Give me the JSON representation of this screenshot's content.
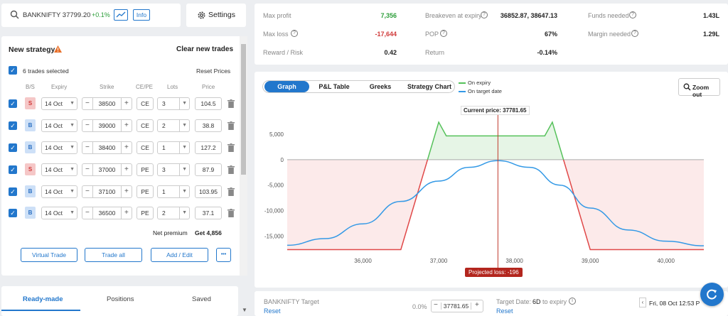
{
  "search": {
    "symbol": "BANKNIFTY 37799.20",
    "change": "+0.1%",
    "info_label": "Info"
  },
  "settings_label": "Settings",
  "strategy": {
    "title": "New strategy",
    "clear_label": "Clear new trades",
    "trades_selected": "6 trades selected",
    "reset_prices": "Reset Prices",
    "headers": {
      "bs": "B/S",
      "expiry": "Expiry",
      "strike": "Strike",
      "cepe": "CE/PE",
      "lots": "Lots",
      "price": "Price"
    },
    "rows": [
      {
        "bs": "S",
        "expiry": "14 Oct",
        "strike": "38500",
        "type": "CE",
        "lots": "3",
        "price": "104.5"
      },
      {
        "bs": "B",
        "expiry": "14 Oct",
        "strike": "39000",
        "type": "CE",
        "lots": "2",
        "price": "38.8"
      },
      {
        "bs": "B",
        "expiry": "14 Oct",
        "strike": "38400",
        "type": "CE",
        "lots": "1",
        "price": "127.2"
      },
      {
        "bs": "S",
        "expiry": "14 Oct",
        "strike": "37000",
        "type": "PE",
        "lots": "3",
        "price": "87.9"
      },
      {
        "bs": "B",
        "expiry": "14 Oct",
        "strike": "37100",
        "type": "PE",
        "lots": "1",
        "price": "103.95"
      },
      {
        "bs": "B",
        "expiry": "14 Oct",
        "strike": "36500",
        "type": "PE",
        "lots": "2",
        "price": "37.1"
      }
    ],
    "net_premium_label": "Net premium",
    "net_premium_value": "Get 4,856",
    "virtual_trade": "Virtual Trade",
    "trade_all": "Trade all",
    "add_edit": "Add / Edit",
    "more": "•••"
  },
  "bottom_tabs": [
    "Ready-made",
    "Positions",
    "Saved"
  ],
  "metrics": {
    "max_profit_label": "Max profit",
    "max_profit": "7,356",
    "max_loss_label": "Max loss",
    "max_loss": "-17,644",
    "rr_label": "Reward / Risk",
    "rr": "0.42",
    "breakeven_label": "Breakeven at expiry",
    "breakeven": "36852.87, 38647.13",
    "pop_label": "POP",
    "pop": "67%",
    "return_label": "Return",
    "return": "-0.14%",
    "funds_label": "Funds needed",
    "funds": "1.43L",
    "margin_label": "Margin needed",
    "margin": "1.29L"
  },
  "chart_tabs": [
    "Graph",
    "P&L Table",
    "Greeks",
    "Strategy Chart"
  ],
  "legend": {
    "expiry": "On expiry",
    "target": "On target date"
  },
  "zoom_label": "Zoom out",
  "current_price_label": "Current price: 37781.65",
  "projected_loss_label": "Projected loss: -196",
  "footer": {
    "target_label": "BANKNIFTY Target",
    "reset": "Reset",
    "pct": "0.0%",
    "target_value": "37781.65",
    "date_label": "Target Date:",
    "date_value": "6D",
    "date_suffix": "to expiry",
    "date_reset": "Reset",
    "datetime": "Fri, 08 Oct 12:53 P"
  },
  "chart_data": {
    "type": "line",
    "x_ticks": [
      36000,
      37000,
      38000,
      39000,
      40000
    ],
    "x_tick_labels": [
      "36,000",
      "37,000",
      "38,000",
      "39,000",
      "40,000"
    ],
    "y_ticks": [
      5000,
      0,
      -5000,
      -10000,
      -15000
    ],
    "y_tick_labels": [
      "5,000",
      "0",
      "-5,000",
      "-10,000",
      "-15,000"
    ],
    "xlim": [
      35000,
      40500
    ],
    "ylim": [
      -18000,
      7500
    ],
    "current_price": 37781.65,
    "series": [
      {
        "name": "On expiry",
        "color": "#55c15a",
        "x": [
          35000,
          36500,
          37000,
          37100,
          38400,
          38500,
          39000,
          40500
        ],
        "y": [
          -17644,
          -17644,
          7356,
          4656,
          4656,
          7356,
          -17644,
          -17644
        ]
      },
      {
        "name": "On target date",
        "color": "#3399e6",
        "x": [
          35000,
          35500,
          36000,
          36500,
          37000,
          37400,
          37781.65,
          38200,
          38600,
          39000,
          39500,
          40000,
          40500
        ],
        "y": [
          -16800,
          -15500,
          -12600,
          -8200,
          -4200,
          -1500,
          -196,
          -1500,
          -5000,
          -9500,
          -13800,
          -16000,
          -16900
        ]
      }
    ]
  }
}
